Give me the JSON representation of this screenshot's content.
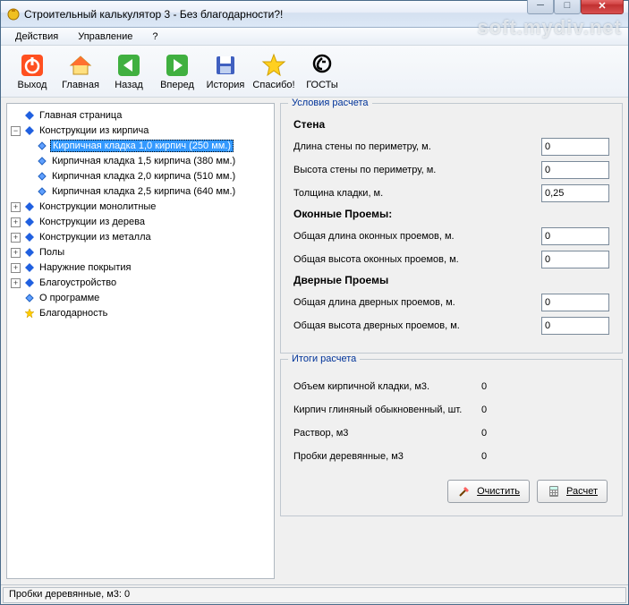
{
  "window": {
    "title": "Строительный калькулятор 3 - Без благодарности?!"
  },
  "watermark": "soft.mydiv.net",
  "menu": {
    "actions": "Действия",
    "manage": "Управление",
    "help": "?"
  },
  "toolbar": {
    "exit": "Выход",
    "home": "Главная",
    "back": "Назад",
    "forward": "Вперед",
    "history": "История",
    "thanks": "Спасибо!",
    "gosts": "ГОСТы"
  },
  "tree": {
    "main": "Главная страница",
    "brick": "Конструкции из кирпича",
    "brick_children": [
      "Кирпичная кладка 1,0 кирпич (250 мм.)",
      "Кирпичная кладка 1,5 кирпича (380 мм.)",
      "Кирпичная кладка 2,0 кирпича  (510 мм.)",
      "Кирпичная кладка 2,5 кирпича  (640 мм.)"
    ],
    "monolithic": "Конструкции монолитные",
    "wood": "Конструкции из дерева",
    "metal": "Конструкции из металла",
    "floors": "Полы",
    "exterior": "Наружние покрытия",
    "landscaping": "Благоустройство",
    "about": "О программе",
    "gratitude": "Благодарность"
  },
  "conditions": {
    "legend": "Условия расчета",
    "wall": "Стена",
    "wall_length_label": "Длина стены по периметру, м.",
    "wall_height_label": "Высота стены по периметру, м.",
    "wall_thickness_label": "Толщина кладки, м.",
    "wall_length": "0",
    "wall_height": "0",
    "wall_thickness": "0,25",
    "windows": "Оконные Проемы:",
    "win_length_label": "Общая длина оконных проемов, м.",
    "win_height_label": "Общая высота оконных проемов, м.",
    "win_length": "0",
    "win_height": "0",
    "doors": "Дверные Проемы",
    "door_length_label": "Общая длина дверных проемов, м.",
    "door_height_label": "Общая высота дверных проемов, м.",
    "door_length": "0",
    "door_height": "0"
  },
  "results": {
    "legend": "Итоги расчета",
    "r1_label": "Объем кирпичной кладки, м3.",
    "r1_val": "0",
    "r2_label": "Кирпич глиняный обыкновенный, шт.",
    "r2_val": "0",
    "r3_label": "Раствор, м3",
    "r3_val": "0",
    "r4_label": "Пробки деревянные, м3",
    "r4_val": "0"
  },
  "buttons": {
    "clear": "Очистить",
    "calc": "Расчет"
  },
  "statusbar": "Пробки деревянные, м3: 0"
}
